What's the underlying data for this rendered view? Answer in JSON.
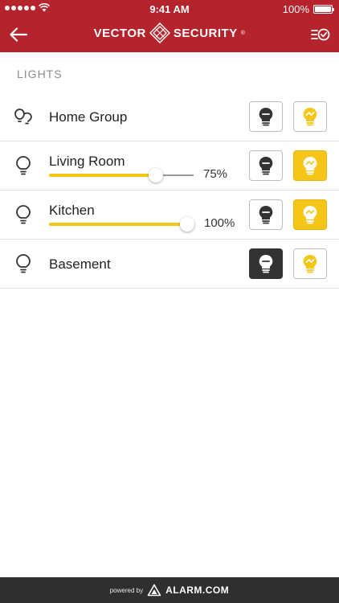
{
  "status": {
    "time": "9:41 AM",
    "battery": "100%"
  },
  "header": {
    "brand_left": "VECTOR",
    "brand_right": "SECURITY",
    "brand_reg": "®"
  },
  "section": {
    "title": "LIGHTS"
  },
  "lights": [
    {
      "name": "Home Group",
      "level": null,
      "state": "none"
    },
    {
      "name": "Living Room",
      "level": 75,
      "level_label": "75%",
      "state": "on"
    },
    {
      "name": "Kitchen",
      "level": 100,
      "level_label": "100%",
      "state": "on"
    },
    {
      "name": "Basement",
      "level": null,
      "state": "off"
    }
  ],
  "footer": {
    "powered_by": "powered by",
    "provider": "ALARM.COM"
  },
  "colors": {
    "header_red": "#b5232c",
    "accent_yellow": "#f5c518",
    "off_dark": "#333333",
    "footer_bg": "#2f2f2f"
  }
}
